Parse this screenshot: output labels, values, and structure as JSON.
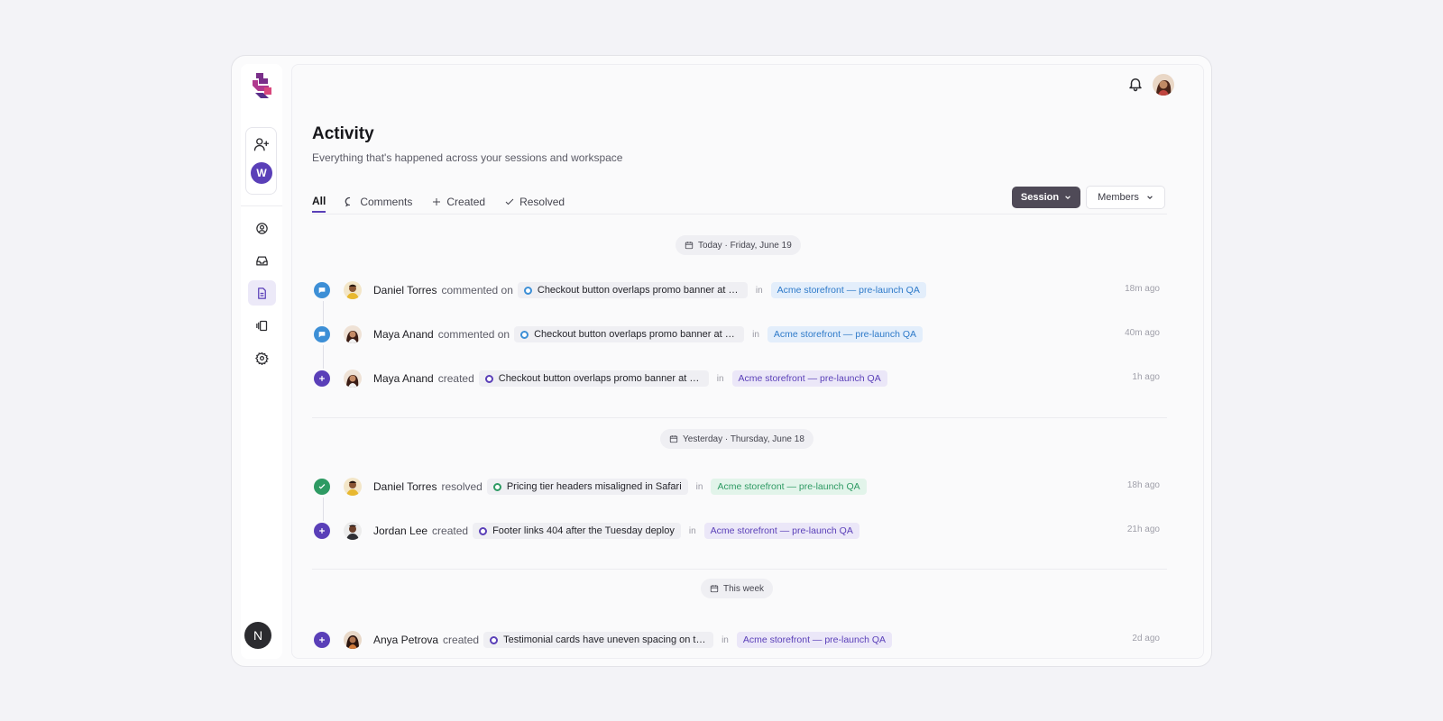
{
  "colors": {
    "accent": "#5a3fb8",
    "comment": "#3d8fd6",
    "resolved": "#2e9a63",
    "session_button": "#4f4a57"
  },
  "sidebar": {
    "workspace_initial": "W",
    "bottom_initial": "N",
    "nav": [
      {
        "icon": "user-circle-icon",
        "active": false
      },
      {
        "icon": "inbox-icon",
        "active": false
      },
      {
        "icon": "document-icon",
        "active": true
      },
      {
        "icon": "sessions-icon",
        "active": false
      },
      {
        "icon": "gear-icon",
        "active": false
      }
    ]
  },
  "header": {
    "title": "Activity",
    "subtitle": "Everything that's happened across your sessions and workspace"
  },
  "tabs": [
    {
      "label": "All",
      "icon": "",
      "active": true
    },
    {
      "label": "Comments",
      "icon": "comment-icon",
      "active": false
    },
    {
      "label": "Created",
      "icon": "plus-icon",
      "active": false
    },
    {
      "label": "Resolved",
      "icon": "check-icon",
      "active": false
    }
  ],
  "filters": {
    "session_label": "Session",
    "members_label": "Members"
  },
  "sections": [
    {
      "date": "Today · Friday, June 19",
      "items": [
        {
          "type": "comment",
          "who": "Daniel Torres",
          "verb": "commented on",
          "issue": "Checkout button overlaps promo banner at mobile breakpoint",
          "in": "in",
          "project": "Acme storefront — pre-launch QA",
          "time": "18m ago"
        },
        {
          "type": "comment",
          "who": "Maya Anand",
          "verb": "commented on",
          "issue": "Checkout button overlaps promo banner at mobile breakpoint",
          "in": "in",
          "project": "Acme storefront — pre-launch QA",
          "time": "40m ago"
        },
        {
          "type": "create",
          "who": "Maya Anand",
          "verb": "created",
          "issue": "Checkout button overlaps promo banner at mobile breakpoint",
          "in": "in",
          "project": "Acme storefront — pre-launch QA",
          "time": "1h ago"
        }
      ]
    },
    {
      "date": "Yesterday · Thursday, June 18",
      "items": [
        {
          "type": "resolve",
          "who": "Daniel Torres",
          "verb": "resolved",
          "issue": "Pricing tier headers misaligned in Safari",
          "in": "in",
          "project": "Acme storefront — pre-launch QA",
          "time": "18h ago"
        },
        {
          "type": "create",
          "who": "Jordan Lee",
          "verb": "created",
          "issue": "Footer links 404 after the Tuesday deploy",
          "in": "in",
          "project": "Acme storefront — pre-launch QA",
          "time": "21h ago"
        }
      ]
    },
    {
      "date": "This week",
      "items": [
        {
          "type": "create",
          "who": "Anya Petrova",
          "verb": "created",
          "issue": "Testimonial cards have uneven spacing on tablet",
          "in": "in",
          "project": "Acme storefront — pre-launch QA",
          "time": "2d ago"
        }
      ]
    }
  ]
}
